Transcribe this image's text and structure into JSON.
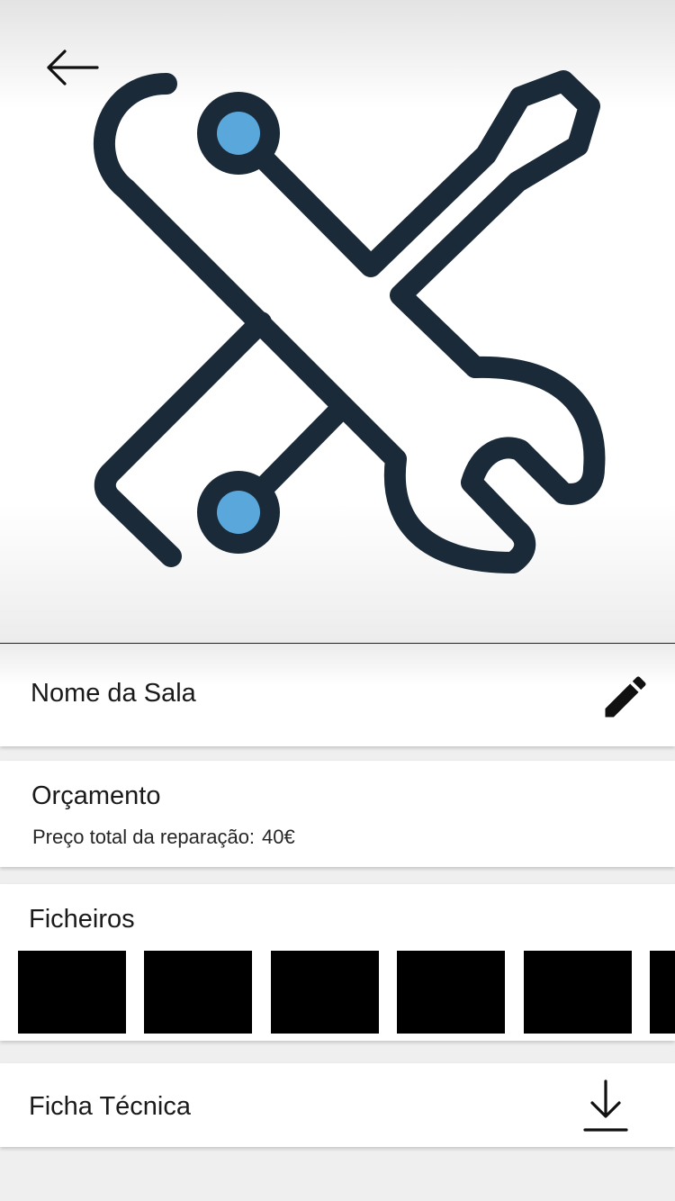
{
  "header": {
    "back_icon": "arrow-left-icon",
    "illustration_icon": "tools-wrench-screwdriver-icon",
    "colors": {
      "stroke": "#1a2a38",
      "accent": "#5aa7dc"
    }
  },
  "room": {
    "name_label": "Nome da Sala",
    "edit_icon": "pencil-icon"
  },
  "budget": {
    "title": "Orçamento",
    "price_label": "Preço total da reparação:",
    "price_value": "40€"
  },
  "files": {
    "title": "Ficheiros",
    "thumbnail_count_visible": 6
  },
  "technical_sheet": {
    "title": "Ficha Técnica",
    "download_icon": "download-icon"
  }
}
